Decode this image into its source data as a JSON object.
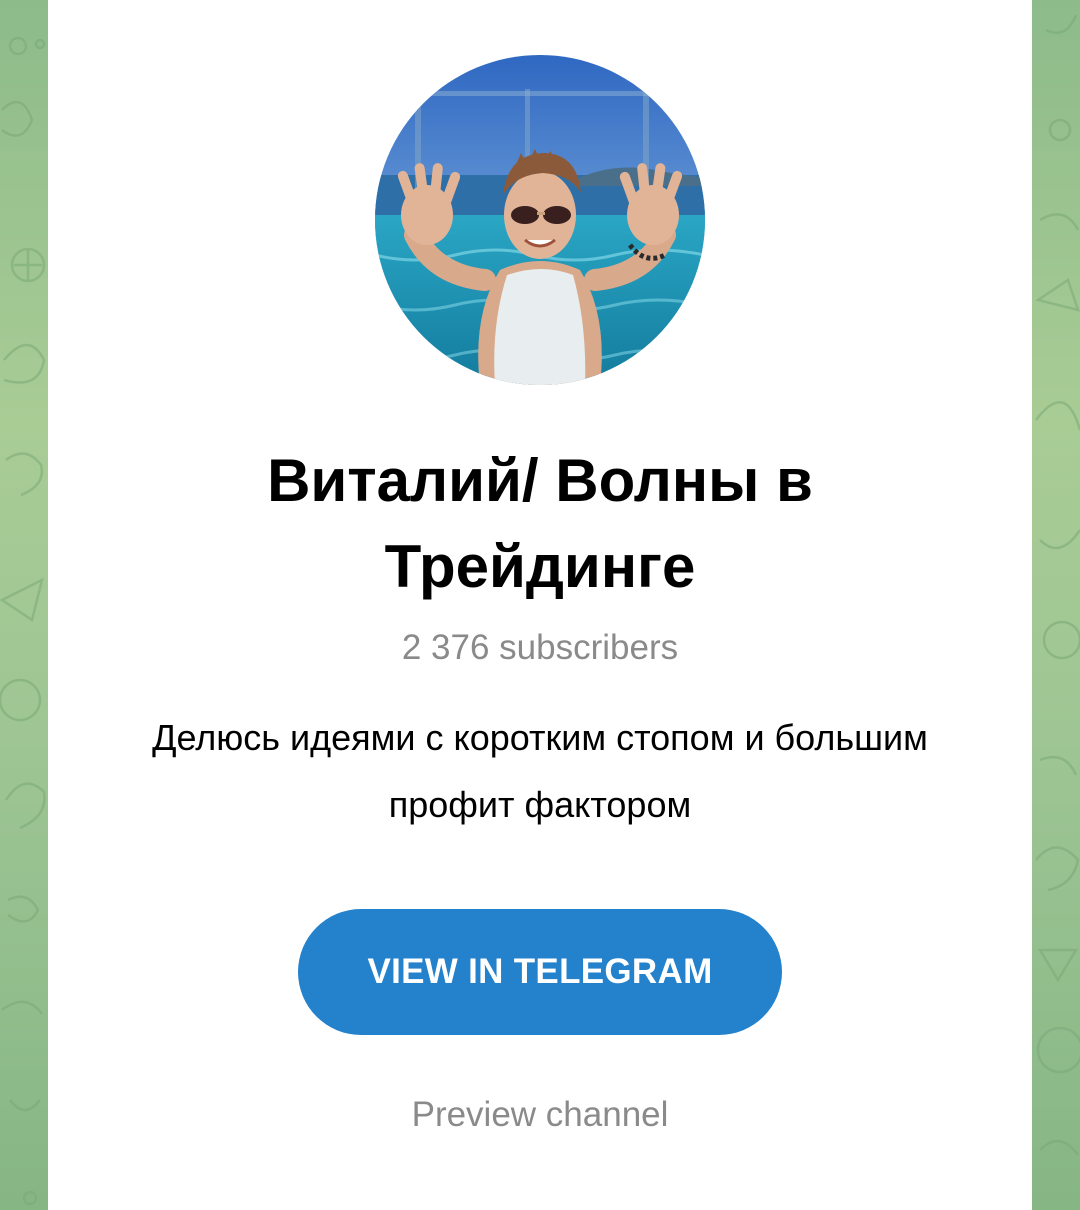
{
  "channel": {
    "title": "Виталий/ Волны в Трейдинге",
    "subscribers": "2 376 subscribers",
    "description": "Делюсь идеями с коротким стопом и большим профит фактором",
    "avatar_icon": "avatar-photo"
  },
  "actions": {
    "view_label": "VIEW IN TELEGRAM",
    "preview_label": "Preview channel"
  },
  "colors": {
    "accent": "#2481cc",
    "background_pattern": "#9cc493",
    "muted_text": "#8a8a8a"
  }
}
